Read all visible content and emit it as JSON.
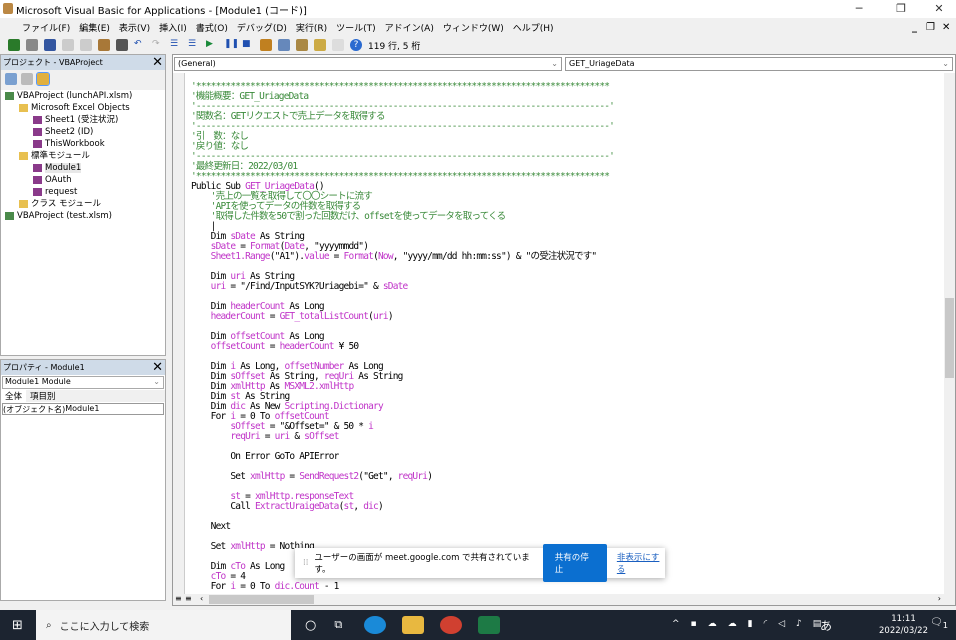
{
  "window": {
    "title": "Microsoft Visual Basic for Applications - [Module1 (コード)]"
  },
  "menu": [
    "ファイル(F)",
    "編集(E)",
    "表示(V)",
    "挿入(I)",
    "書式(O)",
    "デバッグ(D)",
    "実行(R)",
    "ツール(T)",
    "アドイン(A)",
    "ウィンドウ(W)",
    "ヘルプ(H)"
  ],
  "toolbar": {
    "position": "119 行, 5 桁"
  },
  "project": {
    "title": "プロジェクト - VBAProject",
    "items": [
      {
        "label": "VBAProject (lunchAPI.xlsm)",
        "level": 0
      },
      {
        "label": "Microsoft Excel Objects",
        "level": 1
      },
      {
        "label": "Sheet1 (受注状況)",
        "level": 2
      },
      {
        "label": "Sheet2 (ID)",
        "level": 2
      },
      {
        "label": "ThisWorkbook",
        "level": 2
      },
      {
        "label": "標準モジュール",
        "level": 1
      },
      {
        "label": "Module1",
        "level": 2
      },
      {
        "label": "OAuth",
        "level": 2
      },
      {
        "label": "request",
        "level": 2
      },
      {
        "label": "クラス モジュール",
        "level": 1
      },
      {
        "label": "VBAProject (test.xlsm)",
        "level": 0
      }
    ]
  },
  "properties": {
    "title": "プロパティ - Module1",
    "object": "Module1 Module",
    "tabs": [
      "全体",
      "項目別"
    ],
    "row_name": "(オブジェクト名)",
    "row_value": "Module1"
  },
  "code": {
    "object_combo": "(General)",
    "proc_combo": "GET_UriageData",
    "lines": [
      [
        [
          "c",
          "'************************************************************************************"
        ]
      ],
      [
        [
          "c",
          "'機能概要：GET_UriageData"
        ]
      ],
      [
        [
          "c",
          "'------------------------------------------------------------------------------------'"
        ]
      ],
      [
        [
          "c",
          "'関数名：GETリクエストで売上データを取得する"
        ]
      ],
      [
        [
          "c",
          "'------------------------------------------------------------------------------------'"
        ]
      ],
      [
        [
          "c",
          "'引　数：なし"
        ]
      ],
      [
        [
          "c",
          "'戻り値：なし"
        ]
      ],
      [
        [
          "c",
          "'------------------------------------------------------------------------------------'"
        ]
      ],
      [
        [
          "c",
          "'最終更新日：2022/03/01"
        ]
      ],
      [
        [
          "c",
          "'************************************************************************************"
        ]
      ],
      [
        [
          "k",
          "Public Sub "
        ],
        [
          "v",
          "GET_UriageData"
        ],
        [
          "k",
          "()"
        ]
      ],
      [
        [
          "c",
          "    '売上の一覧を取得して〇〇シートに流す"
        ]
      ],
      [
        [
          "c",
          "    'APIを使ってデータの件数を取得する"
        ]
      ],
      [
        [
          "c",
          "    '取得した件数を50で割った回数だけ、offsetを使ってデータを取ってくる"
        ]
      ],
      [
        [
          "k",
          "    |"
        ]
      ],
      [
        [
          "k",
          "    Dim "
        ],
        [
          "v",
          "sDate"
        ],
        [
          "k",
          " As String"
        ]
      ],
      [
        [
          "v",
          "    sDate"
        ],
        [
          "k",
          " = "
        ],
        [
          "v",
          "Format"
        ],
        [
          "k",
          "("
        ],
        [
          "v",
          "Date"
        ],
        [
          "k",
          ", \"yyyymmdd\")"
        ]
      ],
      [
        [
          "v",
          "    Sheet1.Range"
        ],
        [
          "k",
          "(\"A1\")."
        ],
        [
          "v",
          "value"
        ],
        [
          "k",
          " = "
        ],
        [
          "v",
          "Format"
        ],
        [
          "k",
          "("
        ],
        [
          "v",
          "Now"
        ],
        [
          "k",
          ", \"yyyy/mm/dd hh:mm:ss\") & \"の受注状況です\""
        ]
      ],
      [],
      [
        [
          "k",
          "    Dim "
        ],
        [
          "v",
          "uri"
        ],
        [
          "k",
          " As String"
        ]
      ],
      [
        [
          "v",
          "    uri"
        ],
        [
          "k",
          " = \"/Find/InputSYK?Uriagebi=\" & "
        ],
        [
          "v",
          "sDate"
        ]
      ],
      [],
      [
        [
          "k",
          "    Dim "
        ],
        [
          "v",
          "headerCount"
        ],
        [
          "k",
          " As Long"
        ]
      ],
      [
        [
          "v",
          "    headerCount"
        ],
        [
          "k",
          " = "
        ],
        [
          "v",
          "GET_totalListCount"
        ],
        [
          "k",
          "("
        ],
        [
          "v",
          "uri"
        ],
        [
          "k",
          ")"
        ]
      ],
      [],
      [
        [
          "k",
          "    Dim "
        ],
        [
          "v",
          "offsetCount"
        ],
        [
          "k",
          " As Long"
        ]
      ],
      [
        [
          "v",
          "    offsetCount"
        ],
        [
          "k",
          " = "
        ],
        [
          "v",
          "headerCount"
        ],
        [
          "k",
          " ¥ 50"
        ]
      ],
      [],
      [
        [
          "k",
          "    Dim "
        ],
        [
          "v",
          "i"
        ],
        [
          "k",
          " As Long, "
        ],
        [
          "v",
          "offsetNumber"
        ],
        [
          "k",
          " As Long"
        ]
      ],
      [
        [
          "k",
          "    Dim "
        ],
        [
          "v",
          "sOffset"
        ],
        [
          "k",
          " As String, "
        ],
        [
          "v",
          "reqUri"
        ],
        [
          "k",
          " As String"
        ]
      ],
      [
        [
          "k",
          "    Dim "
        ],
        [
          "v",
          "xmlHttp"
        ],
        [
          "k",
          " As "
        ],
        [
          "v",
          "MSXML2.xmlHttp"
        ]
      ],
      [
        [
          "k",
          "    Dim "
        ],
        [
          "v",
          "st"
        ],
        [
          "k",
          " As String"
        ]
      ],
      [
        [
          "k",
          "    Dim "
        ],
        [
          "v",
          "dic"
        ],
        [
          "k",
          " As New "
        ],
        [
          "v",
          "Scripting.Dictionary"
        ]
      ],
      [
        [
          "k",
          "    For "
        ],
        [
          "v",
          "i"
        ],
        [
          "k",
          " = 0 To "
        ],
        [
          "v",
          "offsetCount"
        ]
      ],
      [
        [
          "v",
          "        sOffset"
        ],
        [
          "k",
          " = \"&Offset=\" & 50 * "
        ],
        [
          "v",
          "i"
        ]
      ],
      [
        [
          "v",
          "        reqUri"
        ],
        [
          "k",
          " = "
        ],
        [
          "v",
          "uri"
        ],
        [
          "k",
          " & "
        ],
        [
          "v",
          "sOffset"
        ]
      ],
      [],
      [
        [
          "k",
          "        On Error GoTo APIError"
        ]
      ],
      [],
      [
        [
          "k",
          "        Set "
        ],
        [
          "v",
          "xmlHttp"
        ],
        [
          "k",
          " = "
        ],
        [
          "v",
          "SendRequest2"
        ],
        [
          "k",
          "(\"Get\", "
        ],
        [
          "v",
          "reqUri"
        ],
        [
          "k",
          ")"
        ]
      ],
      [],
      [
        [
          "v",
          "        st"
        ],
        [
          "k",
          " = "
        ],
        [
          "v",
          "xmlHttp.responseText"
        ]
      ],
      [
        [
          "k",
          "        Call "
        ],
        [
          "v",
          "ExtractUraigeData"
        ],
        [
          "k",
          "("
        ],
        [
          "v",
          "st"
        ],
        [
          "k",
          ", "
        ],
        [
          "v",
          "dic"
        ],
        [
          "k",
          ")"
        ]
      ],
      [],
      [
        [
          "k",
          "    Next"
        ]
      ],
      [],
      [
        [
          "k",
          "    Set "
        ],
        [
          "v",
          "xmlHttp"
        ],
        [
          "k",
          " = Nothing"
        ]
      ],
      [],
      [
        [
          "k",
          "    Dim "
        ],
        [
          "v",
          "cTo"
        ],
        [
          "k",
          " As Long"
        ]
      ],
      [
        [
          "v",
          "    cTo"
        ],
        [
          "k",
          " = 4"
        ]
      ],
      [
        [
          "k",
          "    For "
        ],
        [
          "v",
          "i"
        ],
        [
          "k",
          " = 0 To "
        ],
        [
          "v",
          "dic.Count"
        ],
        [
          "k",
          " - 1"
        ]
      ]
    ]
  },
  "notice": {
    "text": "ユーザーの画面が meet.google.com で共有されています。",
    "stop": "共有の停止",
    "hide": "非表示にする"
  },
  "taskbar": {
    "search_placeholder": "ここに入力して検索",
    "time": "11:11",
    "date": "2022/03/22",
    "ime": "あ",
    "notifications": "1"
  },
  "colors": {
    "comment": "#3a8a3a",
    "identifier": "#c034c8",
    "accent": "#0b6fd0"
  }
}
